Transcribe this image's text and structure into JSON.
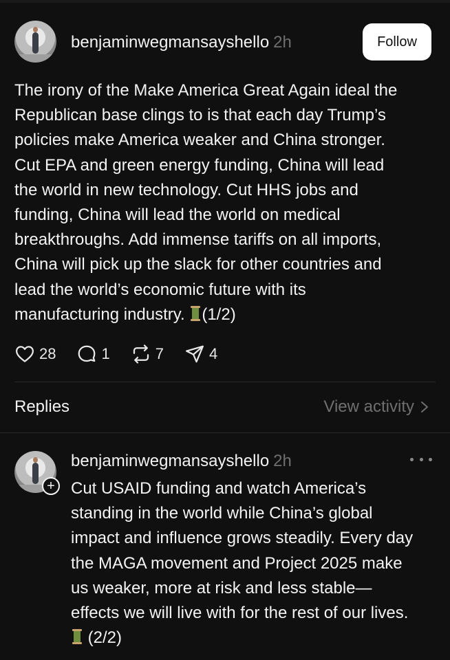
{
  "post": {
    "username": "benjaminwegmansayshello",
    "time": "2h",
    "follow_label": "Follow",
    "text_lines": [
      "The irony of the Make America Great Again ideal the",
      "Republican base clings to is that each day Trump’s",
      "policies make America weaker and China stronger.",
      "Cut EPA and green energy funding, China will lead",
      "the world in new technology. Cut HHS jobs and",
      "funding, China will lead the world on medical",
      "breakthroughs. Add immense tariffs on all imports,",
      "China will pick up the slack for other countries and",
      "lead the world’s economic future with its"
    ],
    "last_line_prefix": "manufacturing industry. ",
    "last_line_suffix": "(1/2)",
    "likes": "28",
    "comments": "1",
    "reposts": "7",
    "shares": "4"
  },
  "replies_header": {
    "label": "Replies",
    "view_activity": "View activity"
  },
  "reply": {
    "username": "benjaminwegmansayshello",
    "time": "2h",
    "text_lines": [
      "Cut USAID funding and watch America’s",
      "standing in the world while China’s global",
      "impact and influence grows steadily. Every day",
      "the MAGA movement and Project 2025 make",
      "us weaker, more at risk and less stable—",
      "effects we will live with for the rest of our lives."
    ],
    "last_line_suffix": " (2/2)"
  },
  "icons": {
    "like": "heart-icon",
    "comment": "comment-icon",
    "repost": "repost-icon",
    "share": "share-icon",
    "thread_emoji": "spool-of-thread-emoji",
    "more": "more-options-icon",
    "chevron": "chevron-right-icon",
    "follow_plus": "plus-icon"
  }
}
